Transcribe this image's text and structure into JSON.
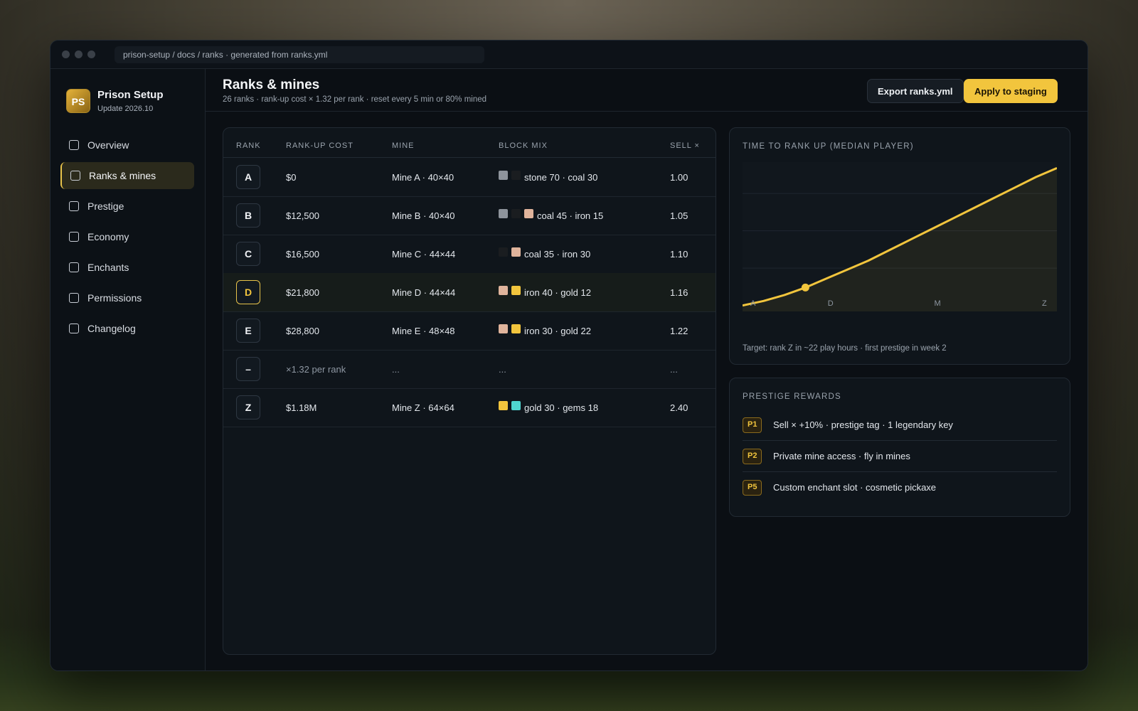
{
  "url_bar": "prison-setup / docs / ranks · generated from ranks.yml",
  "brand": {
    "logo": "PS",
    "title": "Prison Setup",
    "subtitle": "Update 2026.10"
  },
  "nav": [
    {
      "label": "Overview",
      "active": false
    },
    {
      "label": "Ranks & mines",
      "active": true
    },
    {
      "label": "Prestige",
      "active": false
    },
    {
      "label": "Economy",
      "active": false
    },
    {
      "label": "Enchants",
      "active": false
    },
    {
      "label": "Permissions",
      "active": false
    },
    {
      "label": "Changelog",
      "active": false
    }
  ],
  "header": {
    "title": "Ranks & mines",
    "subtitle": "26 ranks · rank-up cost × 1.32 per rank · reset every 5 min or 80% mined",
    "export_label": "Export ranks.yml",
    "apply_label": "Apply to staging"
  },
  "table": {
    "columns": [
      "RANK",
      "RANK-UP COST",
      "MINE",
      "BLOCK MIX",
      "SELL ×"
    ],
    "rows": [
      {
        "rank": "A",
        "cost": "$0",
        "mine": "Mine A · 40×40",
        "swatches": [
          "#8e949c",
          "#1a1d20"
        ],
        "mix": "stone 70 · coal 30",
        "sell": "1.00",
        "highlight": false
      },
      {
        "rank": "B",
        "cost": "$12,500",
        "mine": "Mine B · 40×40",
        "swatches": [
          "#8e949c",
          "#1a1d20",
          "#e0b49c"
        ],
        "mix": "coal 45 · iron 15",
        "sell": "1.05",
        "highlight": false
      },
      {
        "rank": "C",
        "cost": "$16,500",
        "mine": "Mine C · 44×44",
        "swatches": [
          "#1a1d20",
          "#e0b49c"
        ],
        "mix": "coal 35 · iron 30",
        "sell": "1.10",
        "highlight": false
      },
      {
        "rank": "D",
        "cost": "$21,800",
        "mine": "Mine D · 44×44",
        "swatches": [
          "#e0b49c",
          "#f2c53d"
        ],
        "mix": "iron 40 · gold 12",
        "sell": "1.16",
        "highlight": true
      },
      {
        "rank": "E",
        "cost": "$28,800",
        "mine": "Mine E · 48×48",
        "swatches": [
          "#e0b49c",
          "#f2c53d"
        ],
        "mix": "iron 30 · gold 22",
        "sell": "1.22",
        "highlight": false
      },
      {
        "rank": "–",
        "cost": "×1.32 per rank",
        "mine": "...",
        "swatches": [],
        "mix": "...",
        "sell": "...",
        "highlight": false,
        "muted": true
      },
      {
        "rank": "Z",
        "cost": "$1.18M",
        "mine": "Mine Z · 64×64",
        "swatches": [
          "#f2c53d",
          "#4fd6d0"
        ],
        "mix": "gold 30 · gems 18",
        "sell": "2.40",
        "highlight": false
      }
    ]
  },
  "chart_data": {
    "type": "area",
    "title": "TIME TO RANK UP (MEDIAN PLAYER)",
    "x_tick_labels": [
      "A",
      "D",
      "M",
      "Z"
    ],
    "points": [
      [
        0,
        0.04
      ],
      [
        1,
        0.07
      ],
      [
        2,
        0.11
      ],
      [
        3,
        0.16
      ],
      [
        4,
        0.22
      ],
      [
        5,
        0.28
      ],
      [
        6,
        0.34
      ],
      [
        7,
        0.41
      ],
      [
        8,
        0.48
      ],
      [
        9,
        0.55
      ],
      [
        10,
        0.62
      ],
      [
        11,
        0.69
      ],
      [
        12,
        0.76
      ],
      [
        13,
        0.83
      ],
      [
        14,
        0.9
      ],
      [
        15,
        0.96
      ]
    ],
    "marker_rank": "D",
    "grid": true,
    "color": "#f2c53d",
    "note": "Target: rank Z in ~22 play hours · first prestige in week 2"
  },
  "prestige": {
    "title": "PRESTIGE REWARDS",
    "rows": [
      {
        "tag": "P1",
        "text": "Sell × +10% · prestige tag · 1 legendary key"
      },
      {
        "tag": "P2",
        "text": "Private mine access · fly in mines"
      },
      {
        "tag": "P5",
        "text": "Custom enchant slot · cosmetic pickaxe"
      }
    ]
  }
}
